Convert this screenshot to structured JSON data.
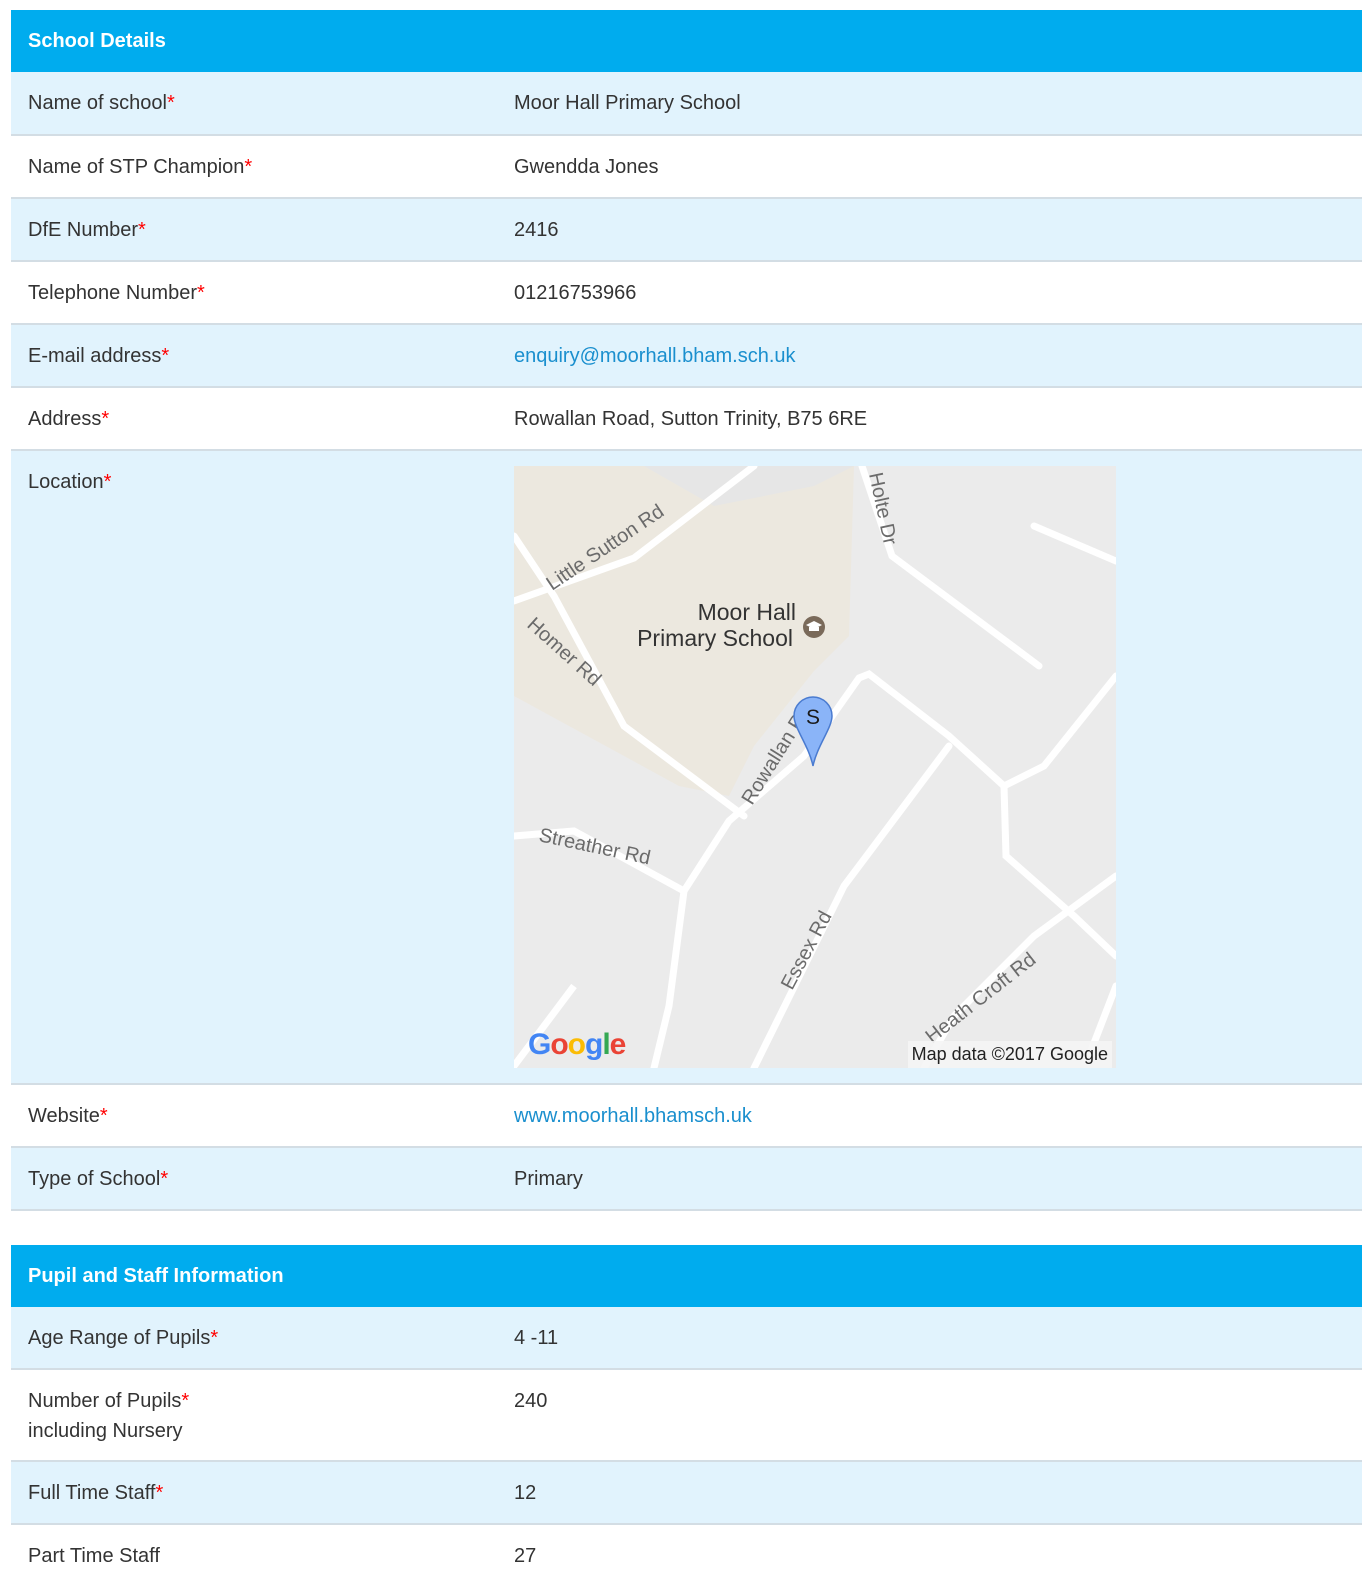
{
  "school_details": {
    "header": "School Details",
    "rows": [
      {
        "label": "Name of school",
        "value": "Moor Hall Primary School"
      },
      {
        "label": "Name of STP Champion",
        "value": "Gwendda Jones"
      },
      {
        "label": "DfE Number",
        "value": "2416"
      },
      {
        "label": "Telephone Number",
        "value": "01216753966"
      },
      {
        "label": "E-mail address",
        "value": "enquiry@moorhall.bham.sch.uk"
      },
      {
        "label": "Address",
        "value": "Rowallan Road, Sutton Trinity, B75 6RE"
      },
      {
        "label": "Location"
      },
      {
        "label": "Website",
        "value": "www.moorhall.bhamsch.uk"
      },
      {
        "label": "Type of School",
        "value": "Primary"
      }
    ],
    "required_marker": "*"
  },
  "map": {
    "place_name_line1": "Moor Hall",
    "place_name_line2": "Primary School",
    "pin_letter": "S",
    "roads": [
      "Little Sutton Rd",
      "Holte Dr",
      "Homer Rd",
      "Rowallan Rd",
      "Streather Rd",
      "Essex Rd",
      "Heath Croft Rd"
    ],
    "logo_letters": [
      "G",
      "o",
      "o",
      "g",
      "l",
      "e"
    ],
    "logo_colors": [
      "#4285f4",
      "#ea4335",
      "#fbbc05",
      "#4285f4",
      "#34a853",
      "#ea4335"
    ],
    "credit": "Map data ©2017 Google"
  },
  "pupil_staff": {
    "header": "Pupil and Staff Information",
    "rows": [
      {
        "label": "Age Range of Pupils",
        "value": "4 -11"
      },
      {
        "label": "Number of Pupils",
        "sublabel": "including Nursery",
        "value": "240"
      },
      {
        "label": "Full Time Staff",
        "value": "12"
      },
      {
        "label": "Part Time Staff",
        "value": "27"
      }
    ]
  },
  "colors": {
    "header_bg": "#00acee",
    "row_alt_bg": "#e1f3fd",
    "required": "#ff0000",
    "link": "#1a8fce"
  }
}
